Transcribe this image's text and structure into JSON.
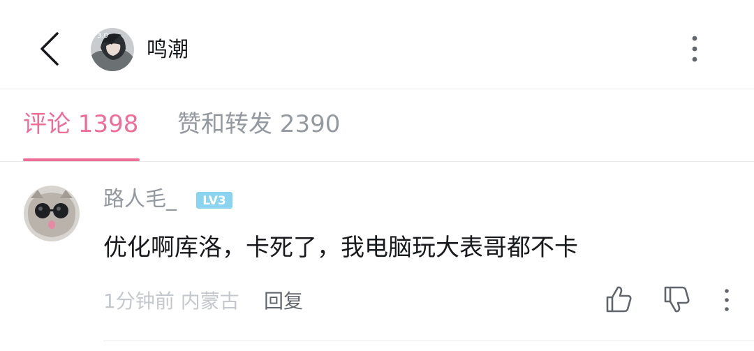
{
  "header": {
    "title": "鸣潮",
    "avatar_badge": "3.0"
  },
  "tabs": {
    "comments_label": "评论 1398",
    "likes_label": "赞和转发 2390",
    "active_color": "#ee6d97",
    "inactive_color": "#9499a0"
  },
  "comment": {
    "username": "路人毛_",
    "level_badge": "LV3",
    "text": "优化啊库洛，卡死了，我电脑玩大表哥都不卡",
    "meta": "1分钟前 内蒙古",
    "reply_label": "回复"
  },
  "icons": {
    "back": "chevron-left-icon",
    "more": "more-vertical-icon",
    "like": "thumbs-up-icon",
    "dislike": "thumbs-down-icon"
  }
}
